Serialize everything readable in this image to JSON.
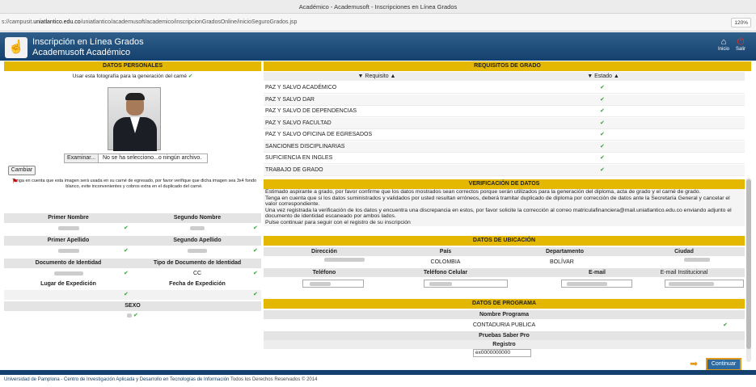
{
  "window": {
    "title": "Académico - Academusoft - Inscripciones en Línea Grados"
  },
  "url": {
    "prefix": "s://campusit.",
    "host": "uniatlantico.edu.co",
    "path": "/uniatlantico/academusoft/academico/inscripcionGradosOnline/inicioSeguroGrados.jsp",
    "zoom": "120%"
  },
  "header": {
    "title1": "Inscripción en Línea Grados",
    "title2": "Academusoft Académico",
    "inicio": "Inicio",
    "salir": "Salir"
  },
  "personal": {
    "title": "DATOS PERSONALES",
    "photo_note": "Usar esta fotografía para la generación del carné",
    "browse_btn": "Examinar...",
    "browse_text": "No se ha selecciono...o ningún archivo.",
    "cambiar": "Cambiar",
    "notice": "Tenga en cuenta que esta imagen será usada en su carné de egresado, por favor verifique que dicha imagen sea 3x4 fondo blanco, evite inconvenientes y cobros extra en el duplicado del carné.",
    "labels": {
      "primer_nombre": "Primer Nombre",
      "segundo_nombre": "Segundo Nombre",
      "primer_apellido": "Primer Apellido",
      "segundo_apellido": "Segundo Apellido",
      "documento": "Documento de Identidad",
      "tipo_documento": "Tipo de Documento de Identidad",
      "lugar": "Lugar de Expedición",
      "fecha": "Fecha de Expedición",
      "sexo": "SEXO"
    },
    "tipo_documento_value": "CC"
  },
  "requisitos": {
    "title": "REQUISITOS DE GRADO",
    "col_req": "▼ Requisito ▲",
    "col_estado": "▼ Estado ▲",
    "items": [
      "PAZ Y SALVO ACADÉMICO",
      "PAZ Y SALVO DAR",
      "PAZ Y SALVO DE DEPENDENCIAS",
      "PAZ Y SALVO FACULTAD",
      "PAZ Y SALVO OFICINA DE EGRESADOS",
      "SANCIONES DISCIPLINARIAS",
      "SUFICIENCIA EN INGLES",
      "TRABAJO DE GRADO"
    ]
  },
  "verificacion": {
    "title": "VERIFICACIÓN DE DATOS",
    "p1": "Estimado aspirante a grado, por favor confirme que los datos mostrados sean correctos porque serán utilizados para la generación del diploma, acta de grado y el carné de grado.",
    "p2": "Tenga en cuenta que si los datos suministrados y validados por usted resultan erróneos, deberá tramitar duplicado de diploma por corrección de datos ante la Secretaría General y cancelar el valor correspondiente.",
    "p3": "Una vez registrada la verificación de los datos y encuentra una discrepancia en estos, por favor solicite la corrección al correo matriculafinanciera@mail.uniatlantico.edu.co enviando adjunto el documento de identidad escaneado por ambos lados.",
    "p4": "Pulse continuar para seguir con el registro de su inscripción"
  },
  "ubicacion": {
    "title": "DATOS DE UBICACIÓN",
    "direccion": "Dirección",
    "pais": "País",
    "departamento": "Departamento",
    "ciudad": "Ciudad",
    "pais_value": "COLOMBIA",
    "departamento_value": "BOLÍVAR",
    "telefono": "Teléfono",
    "celular": "Teléfono Celular",
    "email": "E-mail",
    "email_inst": "E-mail Institucional"
  },
  "programa": {
    "title": "DATOS DE PROGRAMA",
    "nombre_label": "Nombre Programa",
    "nombre_value": "CONTADURIA PUBLICA",
    "saber_pro": "Pruebas Saber Pro",
    "registro": "Registro",
    "registro_value": "ex0000000000"
  },
  "continuar": "Continuar",
  "footer": {
    "link": "Universidad de Pamplona - Centro de Investigación Aplicada y Desarrollo en Tecnologías de Información",
    "rights": "Todos los Derechos Reservados © 2014"
  },
  "colors": {
    "header": "#14406d",
    "yellow": "#e4b800",
    "ok": "#2ea52e",
    "accent": "#e39a1c"
  }
}
